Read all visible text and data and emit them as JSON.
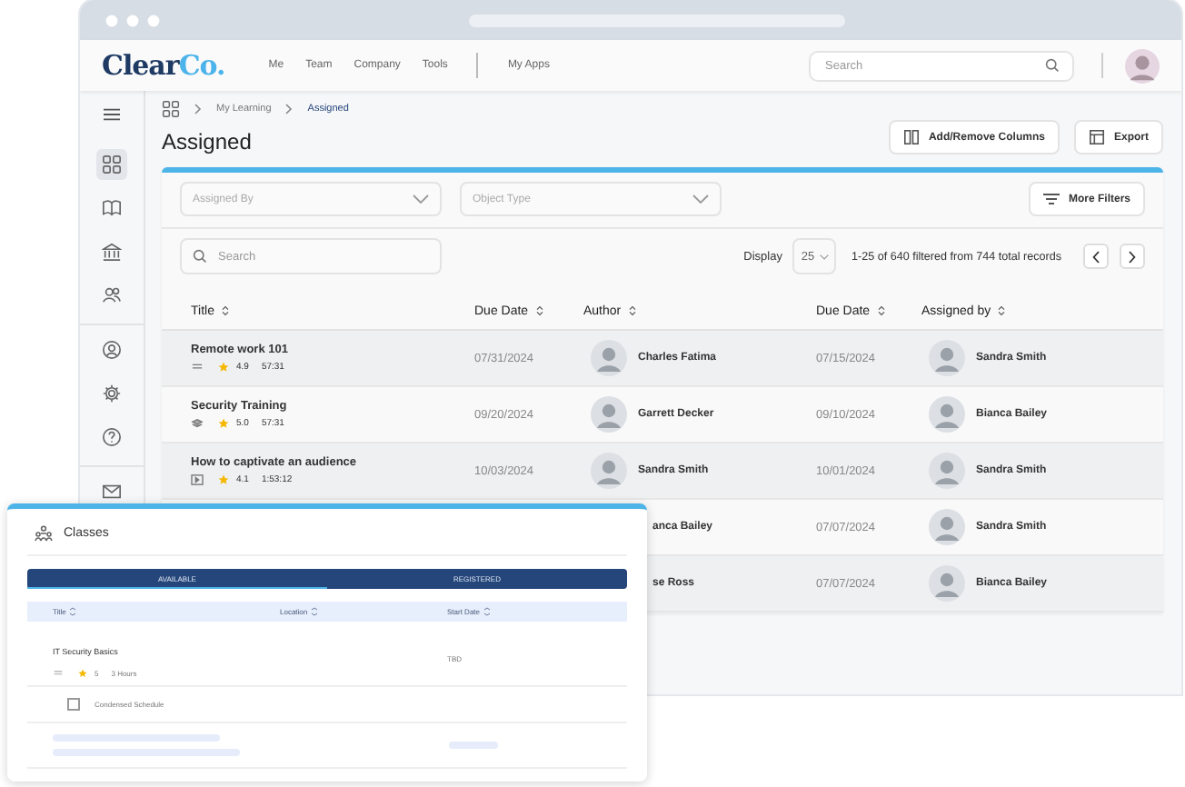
{
  "logo": {
    "text": "Clear",
    "accent": "Co."
  },
  "nav": [
    {
      "label": "Me"
    },
    {
      "label": "Team"
    },
    {
      "label": "Company"
    },
    {
      "label": "Tools"
    },
    {
      "label": "My Apps"
    }
  ],
  "search": {
    "placeholder": "Search"
  },
  "sidebar": {
    "items": [
      {
        "kind": "grid",
        "selected": true
      },
      {
        "kind": "book",
        "selected": false
      },
      {
        "kind": "bank",
        "selected": false
      },
      {
        "kind": "people",
        "selected": false
      },
      {
        "kind": "user",
        "selected": false
      },
      {
        "kind": "gear",
        "selected": false
      },
      {
        "kind": "help",
        "selected": false
      },
      {
        "kind": "mail",
        "selected": false
      }
    ]
  },
  "breadcrumb": [
    "My Learning",
    "Assigned"
  ],
  "page_title": "Assigned",
  "actions": [
    {
      "kind": "columns",
      "label": "Add/Remove Columns"
    },
    {
      "kind": "export",
      "label": "Export"
    }
  ],
  "filters": [
    {
      "placeholder": "Assigned By"
    },
    {
      "placeholder": "Object Type"
    }
  ],
  "more_filters": "More Filters",
  "table_search": {
    "placeholder": "Search"
  },
  "display": {
    "label": "Display",
    "value": "25"
  },
  "records": "1-25 of 640 filtered from 744 total records",
  "table": {
    "columns": [
      "Title",
      "Due Date",
      "Author",
      "Due Date",
      "Assigned by"
    ],
    "rows": [
      {
        "title": "Remote work 101",
        "kind": "document",
        "rating": "4.9",
        "duration": "57:31",
        "due": "07/31/2024",
        "author": {
          "name": "Charles Fatima",
          "avatar": true
        },
        "due2": "07/15/2024",
        "assigned_by": "Sandra Smith"
      },
      {
        "title": "Security Training",
        "kind": "stack",
        "rating": "5.0",
        "duration": "57:31",
        "due": "09/20/2024",
        "author": {
          "name": "Garrett Decker",
          "avatar": true
        },
        "due2": "09/10/2024",
        "assigned_by": "Bianca Bailey"
      },
      {
        "title": "How to captivate an audience",
        "kind": "video",
        "rating": "4.1",
        "duration": "1:53:12",
        "due": "10/03/2024",
        "author": {
          "name": "Sandra Smith",
          "avatar": true
        },
        "due2": "10/01/2024",
        "assigned_by": "Sandra Smith"
      },
      {
        "author": {
          "name": "anca Bailey"
        },
        "due2": "07/07/2024",
        "assigned_by": "Sandra Smith"
      },
      {
        "author": {
          "name": "se Ross"
        },
        "due2": "07/07/2024",
        "assigned_by": "Bianca Bailey"
      }
    ]
  },
  "classes": {
    "title": "Classes",
    "tabs": [
      {
        "label": "AVAILABLE",
        "selected": true
      },
      {
        "label": "REGISTERED",
        "selected": false
      }
    ],
    "columns": [
      "Title",
      "Location",
      "Start Date"
    ],
    "rows": [
      {
        "title": "IT Security Basics",
        "rating": "5",
        "duration": "3 Hours",
        "start": "TBD"
      }
    ],
    "option": {
      "label": "Condensed Schedule",
      "checked": false
    }
  }
}
